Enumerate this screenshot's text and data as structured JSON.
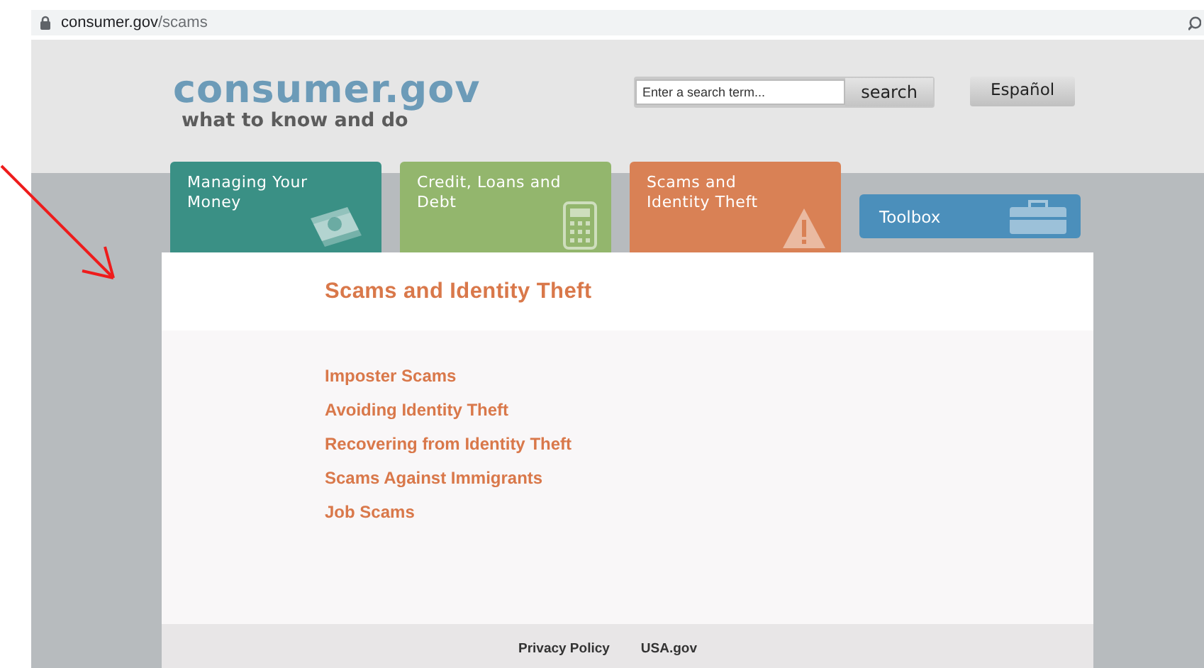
{
  "address_bar": {
    "host": "consumer.gov",
    "path": "/scams"
  },
  "header": {
    "logo": "consumer.gov",
    "tagline": "what to know and do",
    "search": {
      "placeholder": "Enter a search term...",
      "button": "search"
    },
    "language_button": "Español"
  },
  "tabs": [
    {
      "label": "Managing Your Money",
      "color": "#3a9085"
    },
    {
      "label": "Credit, Loans and Debt",
      "color": "#93b66d"
    },
    {
      "label": "Scams and Identity Theft",
      "color": "#d98155"
    }
  ],
  "toolbox": {
    "label": "Toolbox"
  },
  "content": {
    "title": "Scams and Identity Theft",
    "links": [
      "Imposter Scams",
      "Avoiding Identity Theft",
      "Recovering from Identity Theft",
      "Scams Against Immigrants",
      "Job Scams"
    ]
  },
  "footer": {
    "links": [
      "Privacy Policy",
      "USA.gov"
    ]
  }
}
